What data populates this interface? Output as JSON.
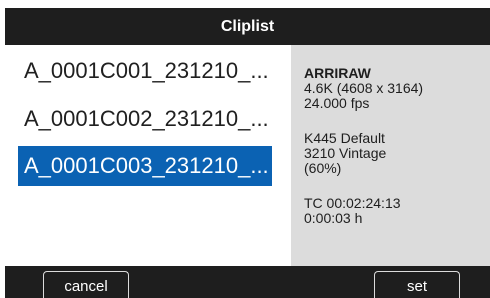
{
  "title": "Cliplist",
  "clips": [
    {
      "name": "A_0001C001_231210_...",
      "selected": false
    },
    {
      "name": "A_0001C002_231210_...",
      "selected": false
    },
    {
      "name": "A_0001C003_231210_...",
      "selected": true
    }
  ],
  "info": {
    "codec": "ARRIRAW",
    "resolution": "4.6K (4608 x 3164)",
    "fps": "24.000 fps",
    "look": "K445 Default",
    "lut": "3210 Vintage",
    "lut_strength": "(60%)",
    "timecode": "TC 00:02:24:13",
    "duration": "0:00:03 h"
  },
  "buttons": {
    "cancel": "cancel",
    "set": "set"
  },
  "colors": {
    "bar": "#1e1e1e",
    "selection": "#0b62b3",
    "info_panel": "#dcdcdc"
  }
}
